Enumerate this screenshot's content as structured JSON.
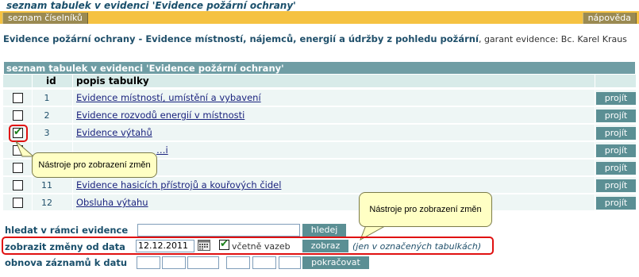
{
  "page": {
    "title": "seznam tabulek v evidenci 'Evidence požární ochrany'"
  },
  "toolbar": {
    "ciselniky_label": "seznam číselníků",
    "napoveda_label": "nápověda"
  },
  "description": {
    "bold": "Evidence požární ochrany - Evidence místností, nájemců, energií a údržby z pohledu požární",
    "rest": ", garant evidence: Bc. Karel Kraus"
  },
  "table": {
    "caption": "seznam tabulek v evidenci 'Evidence požární ochrany'",
    "headers": {
      "id": "id",
      "popis": "popis tabulky"
    },
    "go_label": "projít",
    "rows": [
      {
        "id": "1",
        "label": "Evidence místností, umístění a vybavení",
        "checked": false
      },
      {
        "id": "2",
        "label": "Evidence rozvodů energií v místnosti",
        "checked": false
      },
      {
        "id": "3",
        "label": "Evidence výtahů",
        "checked": true
      },
      {
        "id": "",
        "label": "…i",
        "checked": false
      },
      {
        "id": "",
        "label": "",
        "checked": false
      },
      {
        "id": "11",
        "label": "Evidence hasicích přístrojů a kouřových čidel",
        "checked": false
      },
      {
        "id": "12",
        "label": "Obsluha výtahu",
        "checked": false
      }
    ]
  },
  "callouts": {
    "first": "Nástroje pro zobrazení změn",
    "second": "Nástroje pro zobrazení změn"
  },
  "form": {
    "search_label": "hledat v rámci evidence",
    "search_value": "",
    "search_button": "hledej",
    "changes_label": "zobrazit změny od data",
    "changes_date": "12.12.2011",
    "include_links_label": "včetně vazeb",
    "include_links_checked": true,
    "show_button": "zobraz",
    "note": "(jen v označených tabulkách)",
    "restore_label": "obnova záznamů k datu",
    "restore_button": "pokračovat"
  },
  "colors": {
    "toolbar": "#f5c242",
    "caption": "#6f9da4",
    "button": "#5b8f94",
    "callout": "#ffffc4",
    "highlight": "#e01010"
  }
}
